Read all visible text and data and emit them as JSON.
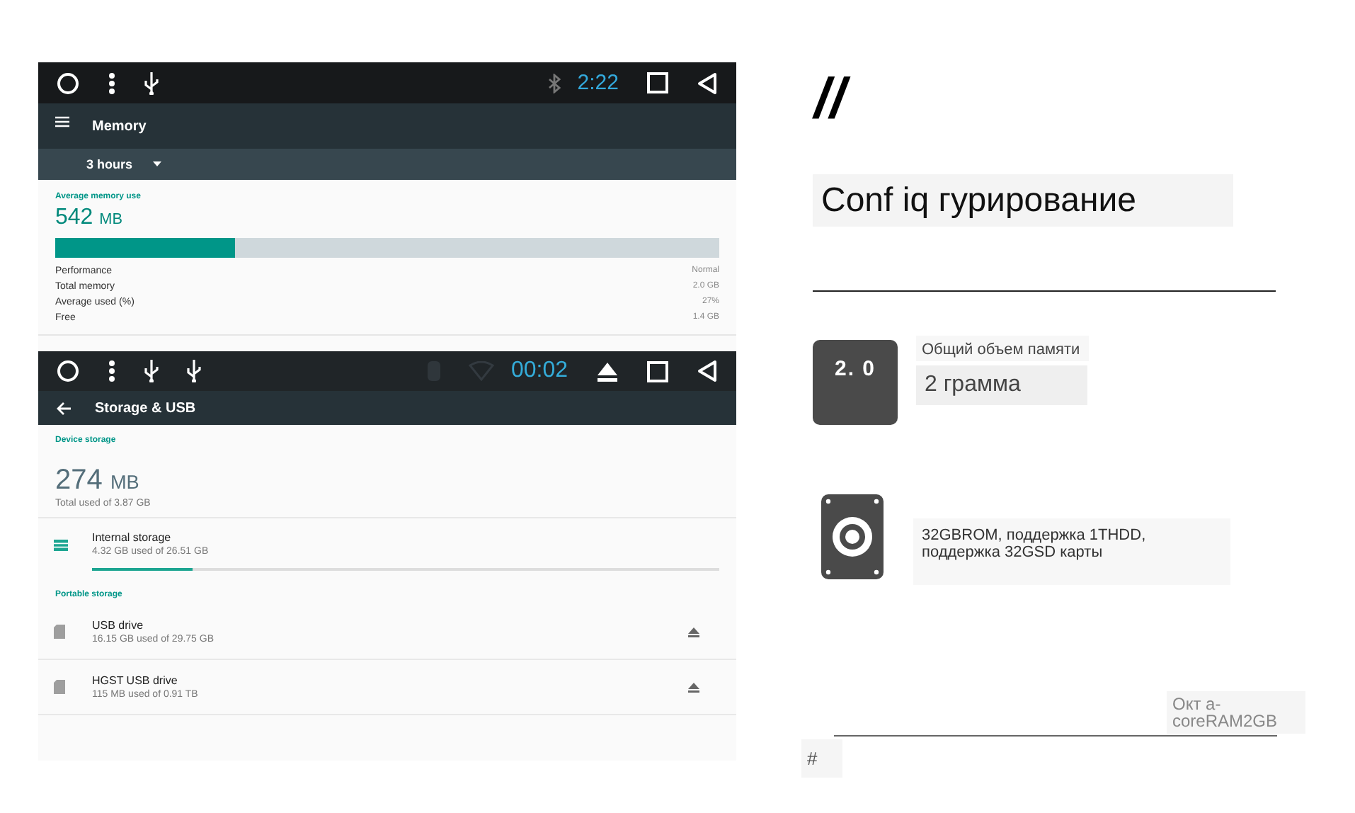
{
  "memory_screen": {
    "status_bar": {
      "time": "2:22"
    },
    "toolbar": {
      "title": "Memory"
    },
    "period": {
      "label": "3 hours"
    },
    "average": {
      "label": "Average memory use",
      "value": "542",
      "unit": "MB",
      "level": 0.27
    },
    "stats": [
      {
        "label": "Performance",
        "value": "Normal"
      },
      {
        "label": "Total memory",
        "value": "2.0 GB"
      },
      {
        "label": "Average used (%)",
        "value": "27%"
      },
      {
        "label": "Free",
        "value": "1.4 GB"
      }
    ]
  },
  "storage_screen": {
    "status_bar": {
      "time": "00:02"
    },
    "toolbar": {
      "title": "Storage & USB"
    },
    "device_storage": {
      "header": "Device storage",
      "value": "274",
      "unit": "MB",
      "caption": "Total used of 3.87 GB"
    },
    "internal": {
      "title": "Internal storage",
      "detail": "4.32 GB used of 26.51 GB",
      "level": 0.16
    },
    "portable_header": "Portable storage",
    "drives": [
      {
        "title": "USB drive",
        "detail": "16.15 GB used of 29.75 GB"
      },
      {
        "title": "HGST USB drive",
        "detail": "115 MB used of 0.91 TB"
      }
    ]
  },
  "spec_panel": {
    "mark": "//",
    "title": "Conf iq гурирование",
    "features": [
      {
        "kind": "chip",
        "chip_label": "2. 0",
        "label": "Общий объем памяти",
        "value": "2 грамма"
      },
      {
        "kind": "disk",
        "text": "32GBROM, поддержка 1THDD, поддержка 32GSD карты"
      }
    ],
    "footer_note": "Окт a-coreRAM2GB",
    "hash": "#"
  }
}
